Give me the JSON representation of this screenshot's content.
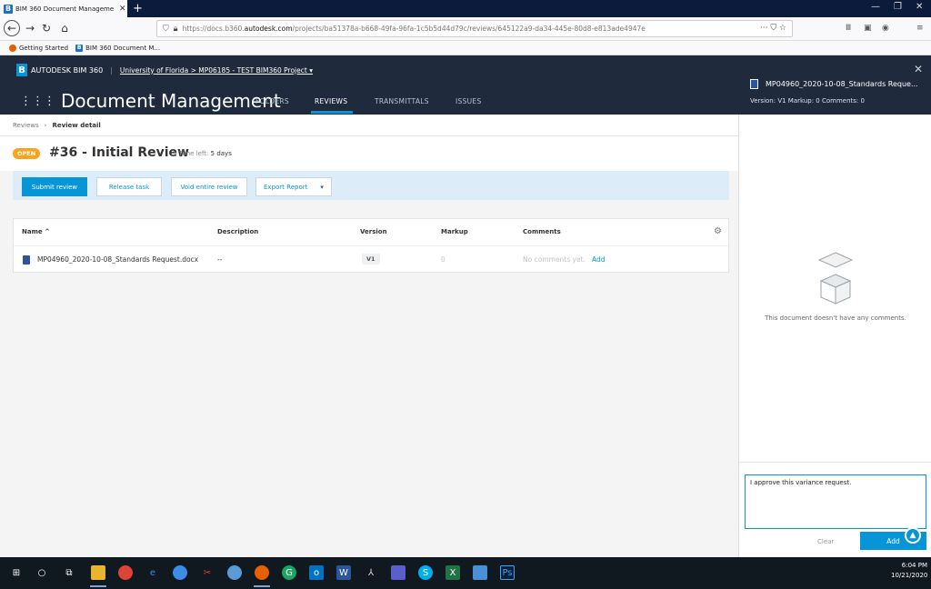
{
  "browser": {
    "tab_title": "BIM 360 Document Manageme",
    "tab_close": "✕",
    "new_tab": "+",
    "url_prefix": "https://docs.b360.",
    "url_domain": "autodesk.com",
    "url_suffix": "/projects/ba51378a-b668-49fa-96fa-1c5b5d44d79c/reviews/645122a9-da34-445e-80d8-e813ade4947e",
    "url_actions": "··· ⛉ ☆",
    "bookmarks": [
      "Getting Started",
      "BIM 360 Document M..."
    ]
  },
  "app": {
    "brand": "AUTODESK  BIM 360",
    "project_path": "University of Florida > MP06185 - TEST BIM360 Project ▾",
    "title": "Document Management",
    "tabs": [
      {
        "label": "FOLDERS"
      },
      {
        "label": "REVIEWS"
      },
      {
        "label": "TRANSMITTALS"
      },
      {
        "label": "ISSUES"
      }
    ]
  },
  "breadcrumb": {
    "parent": "Reviews",
    "separator": "›",
    "current": "Review detail"
  },
  "review": {
    "status": "OPEN",
    "title": "#36 - Initial Review",
    "time_left_label": "Time left:",
    "time_left_value": "5 days"
  },
  "actions": {
    "submit": "Submit review",
    "release": "Release task",
    "void": "Void entire review",
    "export": "Export Report"
  },
  "table": {
    "columns": {
      "name": "Name ^",
      "description": "Description",
      "version": "Version",
      "markup": "Markup",
      "comments": "Comments"
    },
    "rows": [
      {
        "name": "MP04960_2020-10-08_Standards Request.docx",
        "description": "--",
        "version": "V1",
        "markup": "0",
        "comments": "No comments yet.",
        "add": "Add"
      }
    ]
  },
  "panel": {
    "doc_title": "MP04960_2020-10-08_Standards Reque...",
    "meta": "Version: V1   Markup: 0   Comments: 0",
    "empty_message": "This document doesn't have any comments.",
    "comment_value": "I approve this variance request.",
    "clear": "Clear",
    "add": "Add"
  },
  "taskbar": {
    "time": "6:04 PM",
    "date": "10/21/2020"
  }
}
